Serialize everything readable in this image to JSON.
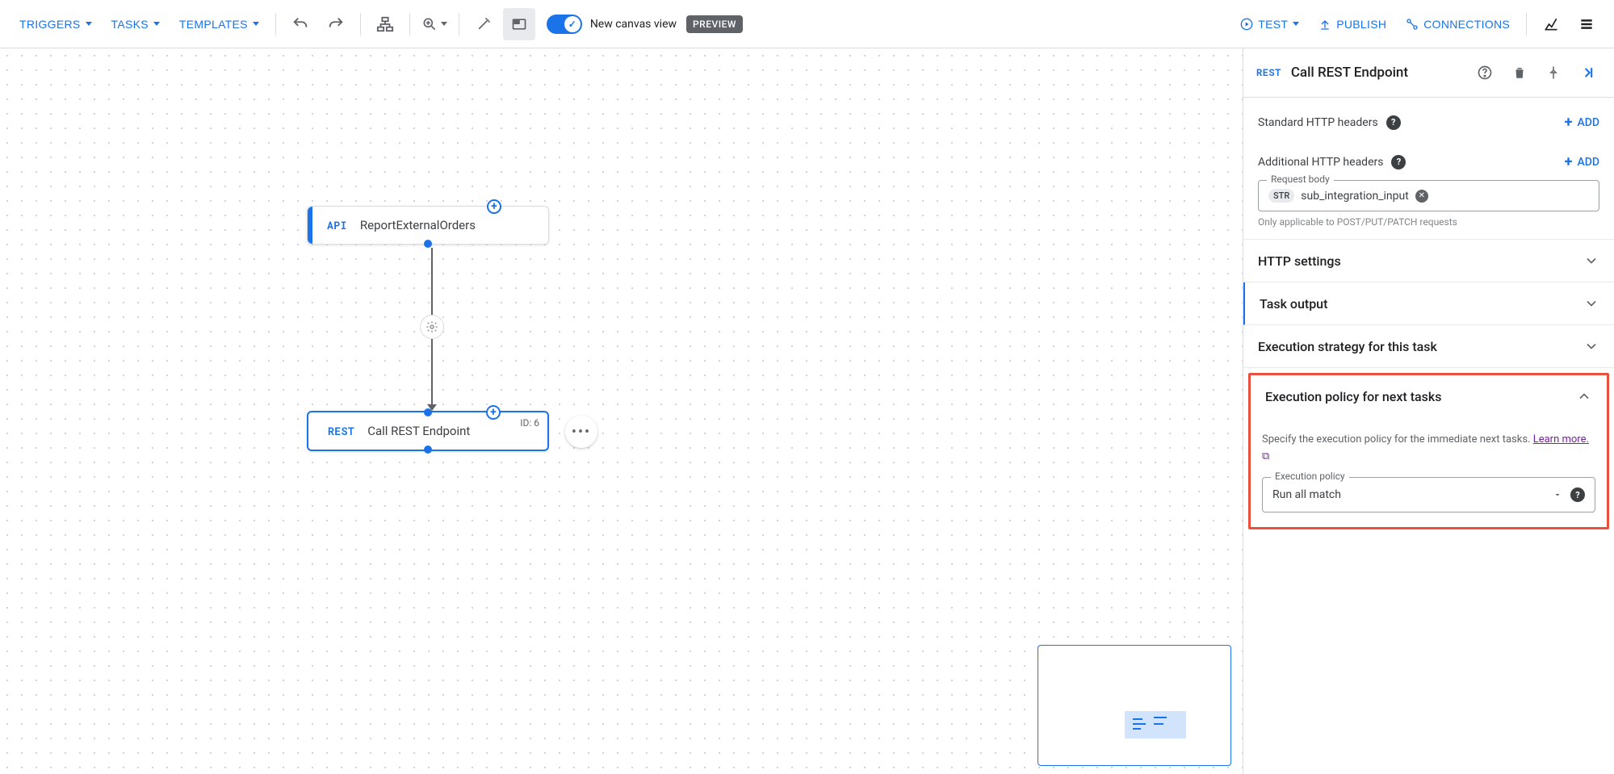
{
  "toolbar": {
    "triggers": "TRIGGERS",
    "tasks": "TASKS",
    "templates": "TEMPLATES",
    "newCanvasLabel": "New canvas view",
    "previewChip": "PREVIEW",
    "test": "TEST",
    "publish": "PUBLISH",
    "connections": "CONNECTIONS"
  },
  "canvas": {
    "triggerNode": {
      "tag": "API",
      "title": "ReportExternalOrders"
    },
    "taskNode": {
      "tag": "REST",
      "title": "Call REST Endpoint",
      "id": "ID: 6"
    }
  },
  "panel": {
    "tag": "REST",
    "title": "Call REST Endpoint",
    "stdHeaders": {
      "label": "Standard HTTP headers",
      "add": "ADD"
    },
    "addlHeaders": {
      "label": "Additional HTTP headers",
      "add": "ADD"
    },
    "requestBody": {
      "label": "Request body",
      "pill": "STR",
      "value": "sub_integration_input",
      "hint": "Only applicable to POST/PUT/PATCH requests"
    },
    "httpSettings": "HTTP settings",
    "taskOutput": "Task output",
    "execStrategy": "Execution strategy for this task",
    "execPolicy": {
      "title": "Execution policy for next tasks",
      "desc": "Specify the execution policy for the immediate next tasks. ",
      "learnMore": "Learn more.",
      "fieldLabel": "Execution policy",
      "value": "Run all match"
    }
  }
}
